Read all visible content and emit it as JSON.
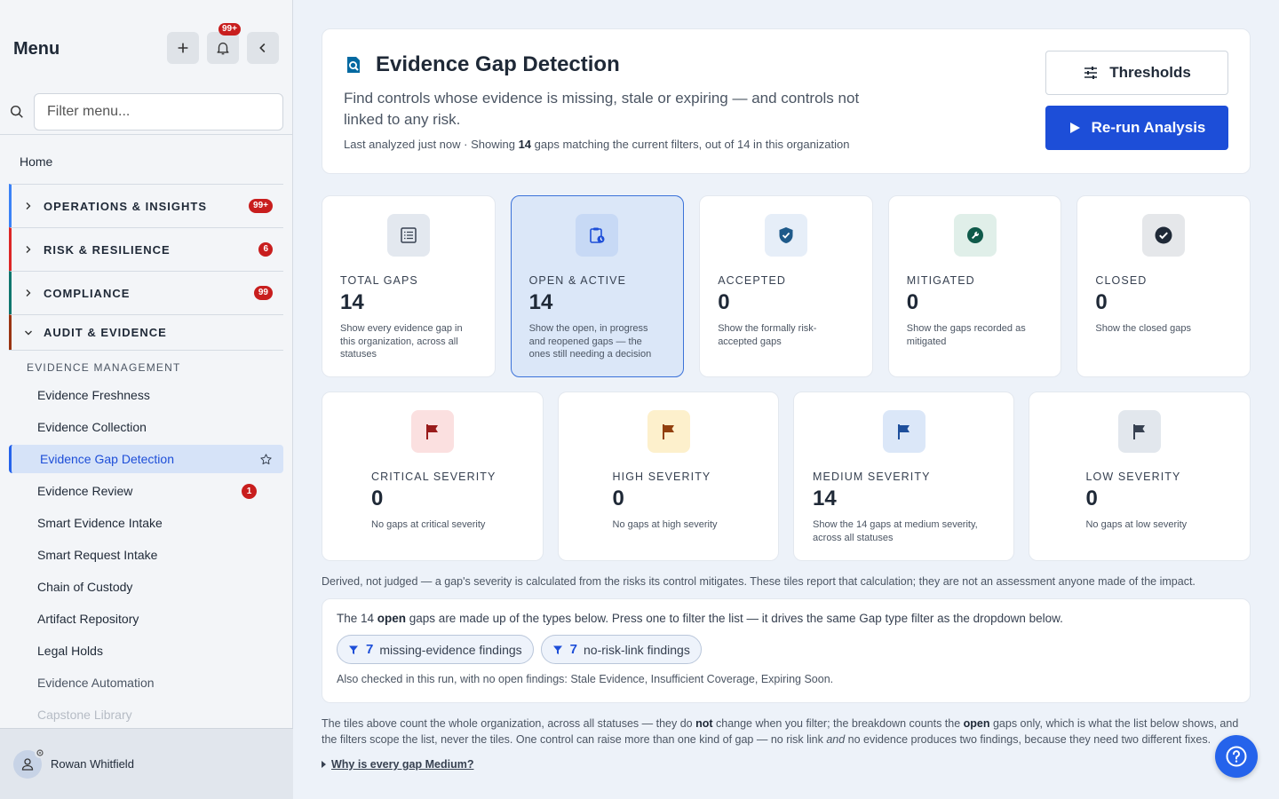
{
  "sidebar": {
    "title": "Menu",
    "notif_badge": "99+",
    "search_placeholder": "Filter menu...",
    "home": "Home",
    "groups": [
      {
        "label": "OPERATIONS & INSIGHTS",
        "badge": "99+",
        "color": "#3b82f6"
      },
      {
        "label": "RISK & RESILIENCE",
        "badge": "6",
        "color": "#dc2626"
      },
      {
        "label": "COMPLIANCE",
        "badge": "99",
        "color": "#0f766e"
      },
      {
        "label": "AUDIT & EVIDENCE",
        "badge": "",
        "color": "#9a3412"
      }
    ],
    "section": "EVIDENCE MANAGEMENT",
    "items": [
      {
        "label": "Evidence Freshness"
      },
      {
        "label": "Evidence Collection"
      },
      {
        "label": "Evidence Gap Detection"
      },
      {
        "label": "Evidence Review",
        "badge": "1"
      },
      {
        "label": "Smart Evidence Intake"
      },
      {
        "label": "Smart Request Intake"
      },
      {
        "label": "Chain of Custody"
      },
      {
        "label": "Artifact Repository"
      },
      {
        "label": "Legal Holds"
      },
      {
        "label": "Evidence Automation"
      },
      {
        "label": "Capstone Library"
      }
    ],
    "user": "Rowan Whitfield"
  },
  "header": {
    "title": "Evidence Gap Detection",
    "desc": "Find controls whose evidence is missing, stale or expiring — and controls not linked to any risk.",
    "meta_pre": "Last analyzed just now · Showing ",
    "meta_count": "14",
    "meta_post": " gaps matching the current filters, out of 14 in this organization",
    "thresholds_label": "Thresholds",
    "rerun_label": "Re-run Analysis"
  },
  "status_tiles": [
    {
      "label": "TOTAL GAPS",
      "value": "14",
      "desc": "Show every evidence gap in this organization, across all statuses",
      "icon": "list-icon",
      "bg": "#e3e8ef",
      "fg": "#374151"
    },
    {
      "label": "OPEN & ACTIVE",
      "value": "14",
      "desc": "Show the open, in progress and reopened gaps — the ones still needing a decision",
      "icon": "clipboard-clock-icon",
      "bg": "#c7d9f5",
      "fg": "#1d4ed8"
    },
    {
      "label": "ACCEPTED",
      "value": "0",
      "desc": "Show the formally risk-accepted gaps",
      "icon": "shield-check-icon",
      "bg": "#e6eef8",
      "fg": "#1e5a8a"
    },
    {
      "label": "MITIGATED",
      "value": "0",
      "desc": "Show the gaps recorded as mitigated",
      "icon": "wrench-icon",
      "bg": "#e0efe9",
      "fg": "#0f5a4a"
    },
    {
      "label": "CLOSED",
      "value": "0",
      "desc": "Show the closed gaps",
      "icon": "check-circle-icon",
      "bg": "#e5e7ea",
      "fg": "#1f2937"
    }
  ],
  "severity_tiles": [
    {
      "label": "CRITICAL SEVERITY",
      "value": "0",
      "desc": "No gaps at critical severity",
      "icon": "flag-icon",
      "bg": "#fbe0e0",
      "fg": "#991b1b"
    },
    {
      "label": "HIGH SEVERITY",
      "value": "0",
      "desc": "No gaps at high severity",
      "icon": "flag-icon",
      "bg": "#fdf0cc",
      "fg": "#92400e"
    },
    {
      "label": "MEDIUM SEVERITY",
      "value": "14",
      "desc": "Show the 14 gaps at medium severity, across all statuses",
      "icon": "flag-icon",
      "bg": "#dbe7f8",
      "fg": "#1e4f9c"
    },
    {
      "label": "LOW SEVERITY",
      "value": "0",
      "desc": "No gaps at low severity",
      "icon": "flag-icon",
      "bg": "#e2e7ed",
      "fg": "#374151"
    }
  ],
  "derived_note": "Derived, not judged — a gap's severity is calculated from the risks its control mitigates. These tiles report that calculation; they are not an assessment anyone made of the impact.",
  "breakdown": {
    "pre": "The 14 ",
    "bold": "open",
    "post": " gaps are made up of the types below. Press one to filter the list — it drives the same Gap type filter as the dropdown below.",
    "chips": [
      {
        "count": "7",
        "label": "missing-evidence findings"
      },
      {
        "count": "7",
        "label": "no-risk-link findings"
      }
    ],
    "also": "Also checked in this run, with no open findings: Stale Evidence, Insufficient Coverage, Expiring Soon."
  },
  "footnote": {
    "p1": "The tiles above count the whole organization, across all statuses — they do ",
    "b1": "not",
    "p2": " change when you filter; the breakdown counts the ",
    "b2": "open",
    "p3": " gaps only, which is what the list below shows, and the filters scope the list, never the tiles. One control can raise more than one kind of gap — no risk link ",
    "i1": "and",
    "p4": " no evidence produces two findings, because they need two different fixes."
  },
  "details_label": "Why is every gap Medium?"
}
